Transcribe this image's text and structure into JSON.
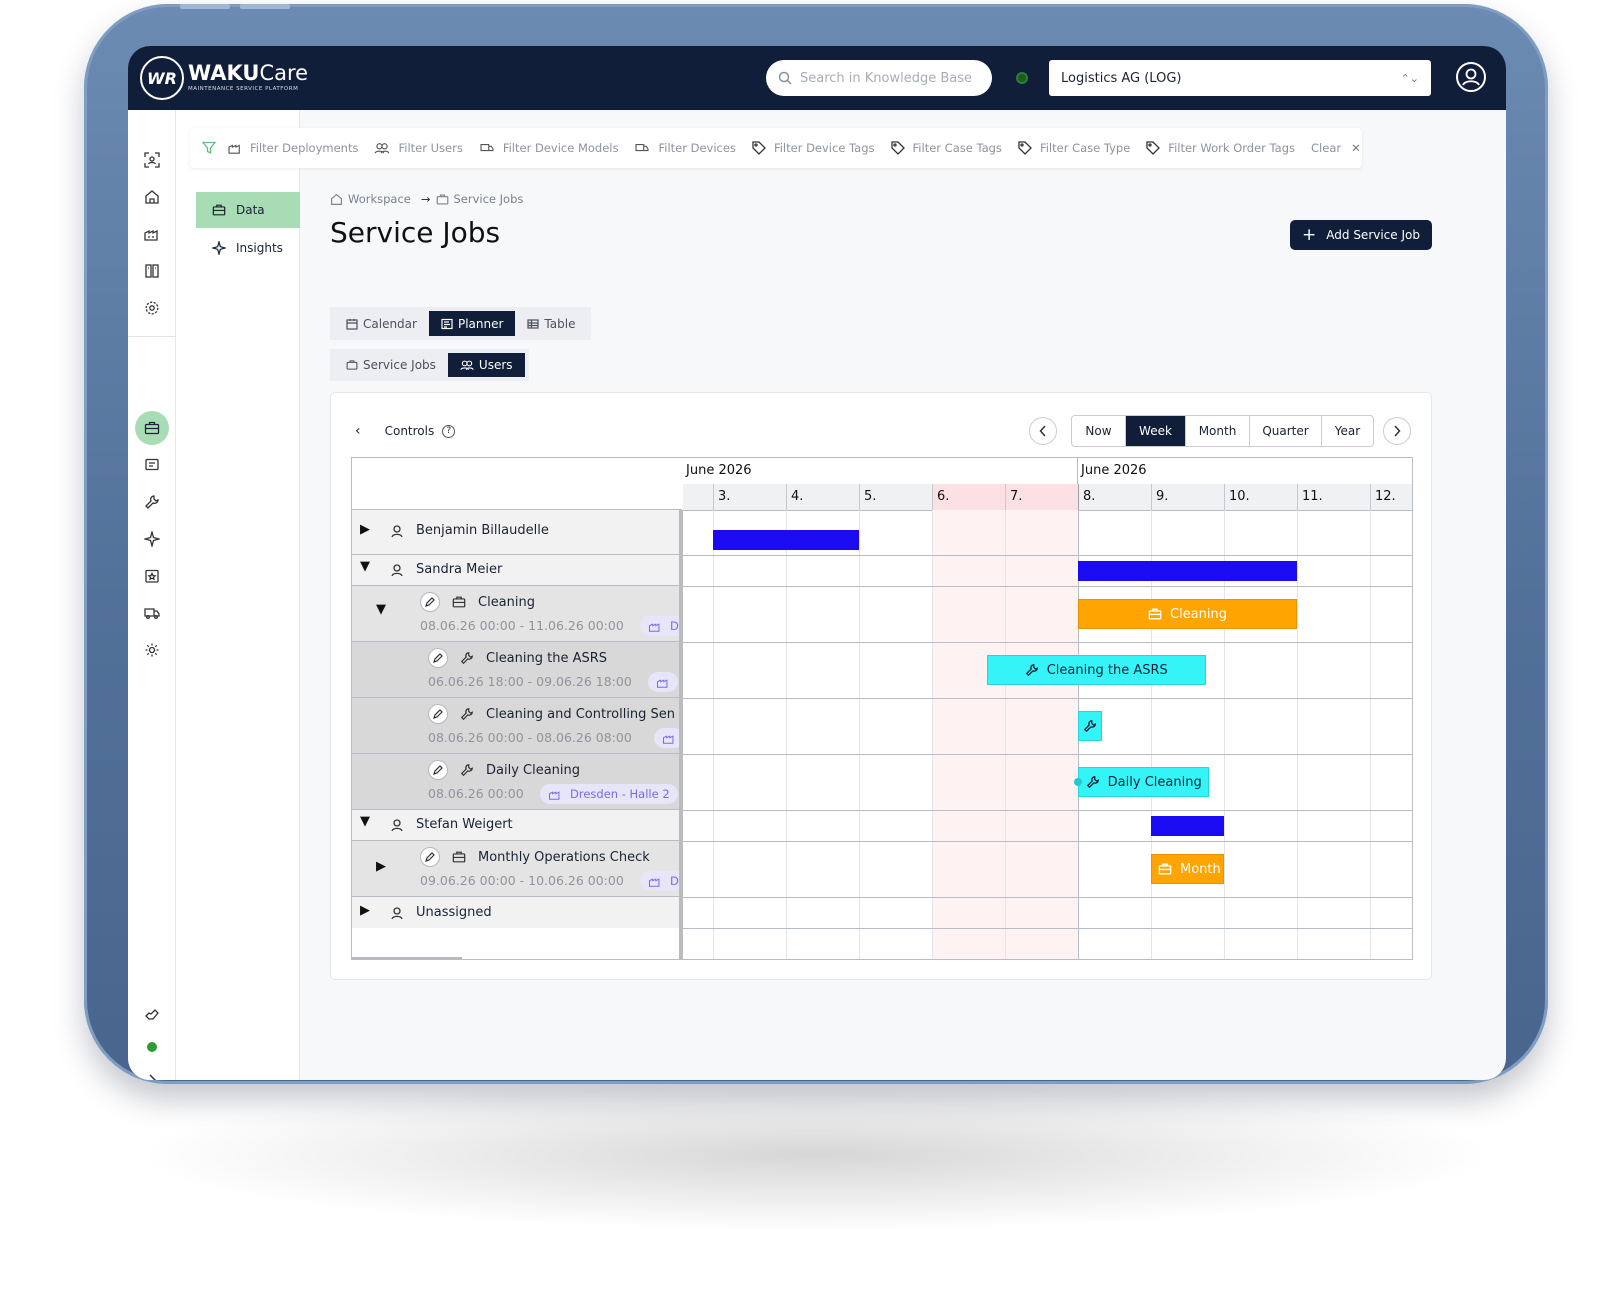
{
  "app": {
    "logo_mark": "WR",
    "brand_bold": "WAKU",
    "brand_light": "Care",
    "tagline": "MAINTENANCE SERVICE PLATFORM"
  },
  "topbar": {
    "search_placeholder": "Search in Knowledge Base",
    "tenant": "Logistics AG  (LOG)"
  },
  "subnav": [
    {
      "label": "Data",
      "icon": "briefcase-icon",
      "active": true
    },
    {
      "label": "Insights",
      "icon": "sparkle-icon",
      "active": false
    }
  ],
  "filters": {
    "items": [
      "Filter Deployments",
      "Filter Users",
      "Filter Device Models",
      "Filter Devices",
      "Filter Device Tags",
      "Filter Case Tags",
      "Filter Case Type",
      "Filter Work Order Tags"
    ],
    "clear": "Clear"
  },
  "breadcrumb": {
    "root": "Workspace",
    "current": "Service Jobs"
  },
  "page_title": "Service Jobs",
  "add_button": "Add Service Job",
  "view_tabs": [
    {
      "label": "Calendar",
      "active": false
    },
    {
      "label": "Planner",
      "active": true
    },
    {
      "label": "Table",
      "active": false
    }
  ],
  "group_tabs": [
    {
      "label": "Service Jobs",
      "active": false
    },
    {
      "label": "Users",
      "active": true
    }
  ],
  "planner": {
    "controls_label": "Controls",
    "range_buttons": [
      {
        "label": "Now",
        "active": false
      },
      {
        "label": "Week",
        "active": true
      },
      {
        "label": "Month",
        "active": false
      },
      {
        "label": "Quarter",
        "active": false
      },
      {
        "label": "Year",
        "active": false
      }
    ],
    "months": [
      "June 2026",
      "June 2026"
    ],
    "days": [
      "3.",
      "4.",
      "5.",
      "6.",
      "7.",
      "8.",
      "9.",
      "10.",
      "11.",
      "12."
    ],
    "weekend_days": [
      "6.",
      "7."
    ],
    "rows": [
      {
        "type": "user",
        "name": "Benjamin Billaudelle",
        "expanded": false
      },
      {
        "type": "user",
        "name": "Sandra Meier",
        "expanded": true
      },
      {
        "type": "job",
        "name": "Cleaning",
        "dates": "08.06.26 00:00 - 11.06.26 00:00",
        "tag": "D",
        "expanded": true
      },
      {
        "type": "task",
        "name": "Cleaning the ASRS",
        "dates": "06.06.26 18:00 - 09.06.26 18:00",
        "tag": ""
      },
      {
        "type": "task",
        "name": "Cleaning and Controlling Sen",
        "dates": "08.06.26 00:00 - 08.06.26 08:00",
        "tag": ""
      },
      {
        "type": "task",
        "name": "Daily Cleaning",
        "dates": "08.06.26 00:00",
        "tag": "Dresden - Halle 2"
      },
      {
        "type": "user",
        "name": "Stefan Weigert",
        "expanded": true
      },
      {
        "type": "job",
        "name": "Monthly Operations Check",
        "dates": "09.06.26 00:00 - 10.06.26 00:00",
        "tag": "D",
        "expanded": false
      },
      {
        "type": "user",
        "name": "Unassigned",
        "expanded": false
      }
    ],
    "bars": [
      {
        "row": "Benjamin Billaudelle",
        "label": "",
        "color": "#1b0bf2",
        "start_day": 3.0,
        "end_day": 5.0
      },
      {
        "row": "Sandra Meier",
        "label": "",
        "color": "#1b0bf2",
        "start_day": 8.0,
        "end_day": 11.0
      },
      {
        "row": "Cleaning",
        "label": "Cleaning",
        "color": "#ffa400",
        "start_day": 8.0,
        "end_day": 11.0
      },
      {
        "row": "Cleaning the ASRS",
        "label": "Cleaning the ASRS",
        "color": "#35f4f7",
        "start_day": 6.75,
        "end_day": 9.75
      },
      {
        "row": "Cleaning and Controlling Sen",
        "label": "",
        "color": "#35f4f7",
        "start_day": 8.0,
        "end_day": 8.33
      },
      {
        "row": "Daily Cleaning",
        "label": "Daily Cleaning",
        "color": "#35f4f7",
        "start_day": 8.0,
        "end_day": 9.8
      },
      {
        "row": "Stefan Weigert",
        "label": "",
        "color": "#1b0bf2",
        "start_day": 9.0,
        "end_day": 10.0
      },
      {
        "row": "Monthly Operations Check",
        "label": "Month",
        "color": "#ffa400",
        "start_day": 9.0,
        "end_day": 10.0
      }
    ]
  }
}
